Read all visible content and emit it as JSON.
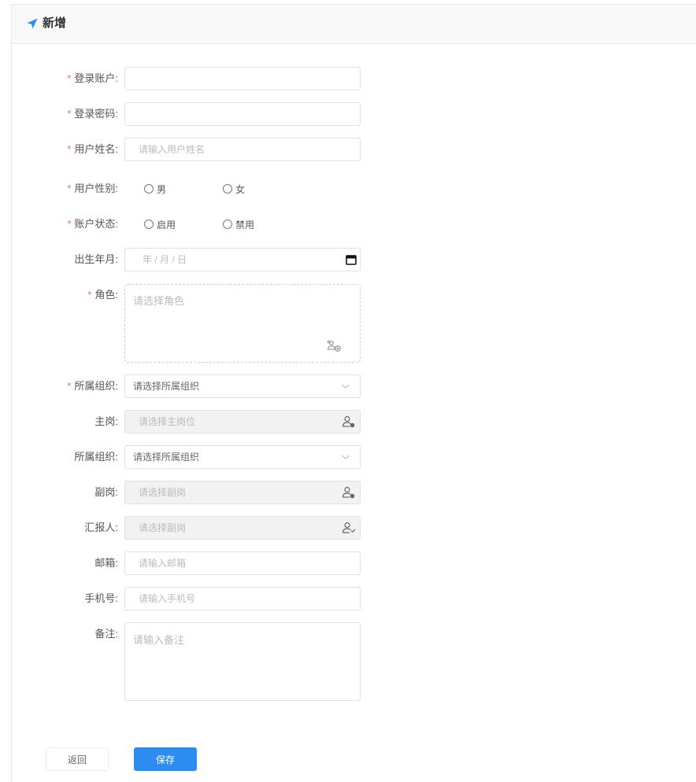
{
  "header": {
    "title": "新增",
    "icon": "send-arrow-icon",
    "icon_color": "#2d8cf0"
  },
  "colors": {
    "required": "#f56c6c",
    "primary": "#2d8cf0"
  },
  "form": {
    "required_mark": "*",
    "account": {
      "label": "登录账户:",
      "value": ""
    },
    "password": {
      "label": "登录密码:",
      "value": ""
    },
    "username": {
      "label": "用户姓名:",
      "placeholder": "请输入用户姓名"
    },
    "gender": {
      "label": "用户性别:",
      "options": [
        "男",
        "女"
      ]
    },
    "status": {
      "label": "账户状态:",
      "options": [
        "启用",
        "禁用"
      ]
    },
    "birth": {
      "label": "出生年月:",
      "placeholder": "年 / 月 / 日",
      "icon": "calendar-icon"
    },
    "role": {
      "label": "角色:",
      "placeholder": "请选择角色",
      "icon": "add-users-icon"
    },
    "org1": {
      "label": "所属组织:",
      "value": "请选择所属组织",
      "icon": "chevron-down-icon"
    },
    "main_post": {
      "label": "主岗:",
      "placeholder": "请选择主岗位",
      "icon": "user-add-icon"
    },
    "org2": {
      "label": "所属组织:",
      "value": "请选择所属组织",
      "icon": "chevron-down-icon"
    },
    "sub_post": {
      "label": "副岗:",
      "placeholder": "请选择副岗",
      "icon": "user-add-icon"
    },
    "reporter": {
      "label": "汇报人:",
      "placeholder": "请选择副岗",
      "icon": "user-check-icon"
    },
    "email": {
      "label": "邮箱:",
      "placeholder": "请输入邮箱"
    },
    "phone": {
      "label": "手机号:",
      "placeholder": "请输入手机号"
    },
    "remark": {
      "label": "备注:",
      "placeholder": "请输入备注"
    }
  },
  "actions": {
    "back": "返回",
    "save": "保存"
  }
}
